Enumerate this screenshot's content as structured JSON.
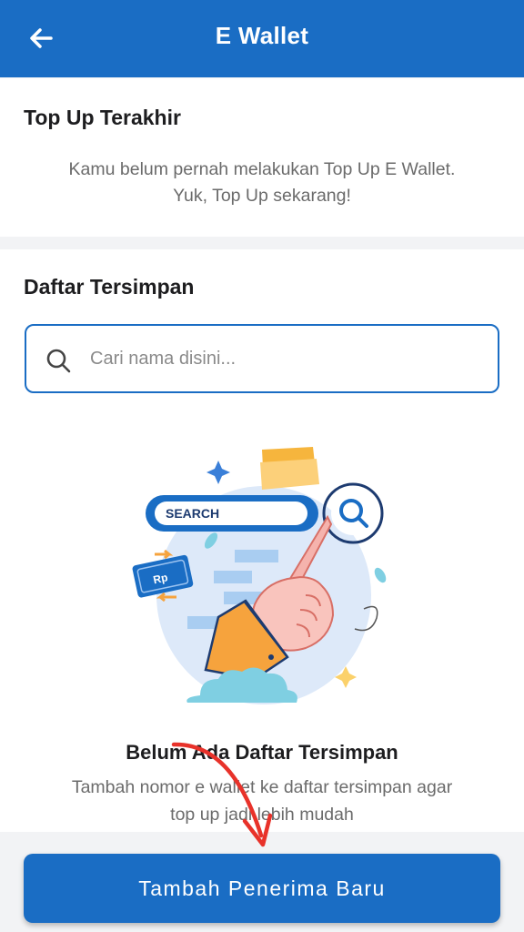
{
  "header": {
    "title": "E Wallet",
    "back_icon": "arrow-left-icon"
  },
  "recent": {
    "title": "Top Up Terakhir",
    "message_line1": "Kamu belum pernah melakukan Top Up E Wallet.",
    "message_line2": "Yuk, Top Up sekarang!"
  },
  "saved": {
    "title": "Daftar Tersimpan",
    "search_placeholder": "Cari nama disini...",
    "search_value": "",
    "illustration": {
      "search_label": "SEARCH",
      "money_label": "Rp"
    },
    "empty_title": "Belum Ada Daftar Tersimpan",
    "empty_desc_line1": "Tambah nomor e wallet ke daftar tersimpan agar",
    "empty_desc_line2": "top up jadi lebih mudah"
  },
  "cta": {
    "label": "Tambah Penerima Baru"
  },
  "colors": {
    "primary": "#1a6dc4",
    "annotation_arrow": "#e8322a"
  }
}
